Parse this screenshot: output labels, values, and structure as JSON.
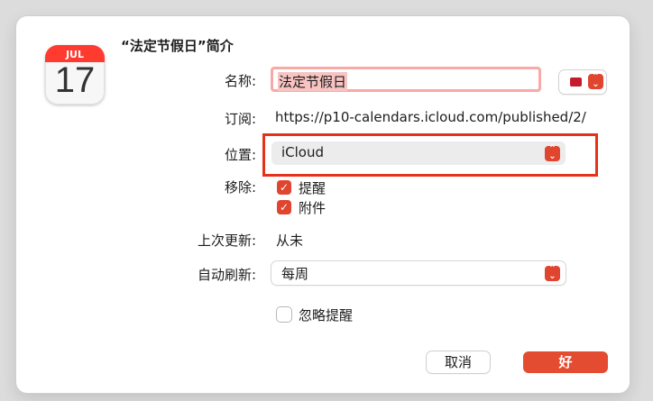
{
  "dialog": {
    "title": "“法定节假日”简介",
    "icon": {
      "name": "calendar-icon",
      "month": "JUL",
      "day": "17"
    }
  },
  "fields": {
    "name": {
      "label": "名称:",
      "value": "法定节假日",
      "color": "#c41c2c"
    },
    "subscription": {
      "label": "订阅:",
      "value": "https://p10-calendars.icloud.com/published/2/"
    },
    "location": {
      "label": "位置:",
      "value": "iCloud"
    },
    "remove": {
      "label": "移除:",
      "options": [
        {
          "label": "提醒",
          "checked": true
        },
        {
          "label": "附件",
          "checked": true
        }
      ]
    },
    "last_updated": {
      "label": "上次更新:",
      "value": "从未"
    },
    "auto_refresh": {
      "label": "自动刷新:",
      "value": "每周"
    },
    "ignore_alerts": {
      "label": "忽略提醒",
      "checked": false
    }
  },
  "buttons": {
    "cancel": "取消",
    "ok": "好"
  },
  "colors": {
    "accent": "#e34c31",
    "highlight": "#e5321b"
  }
}
